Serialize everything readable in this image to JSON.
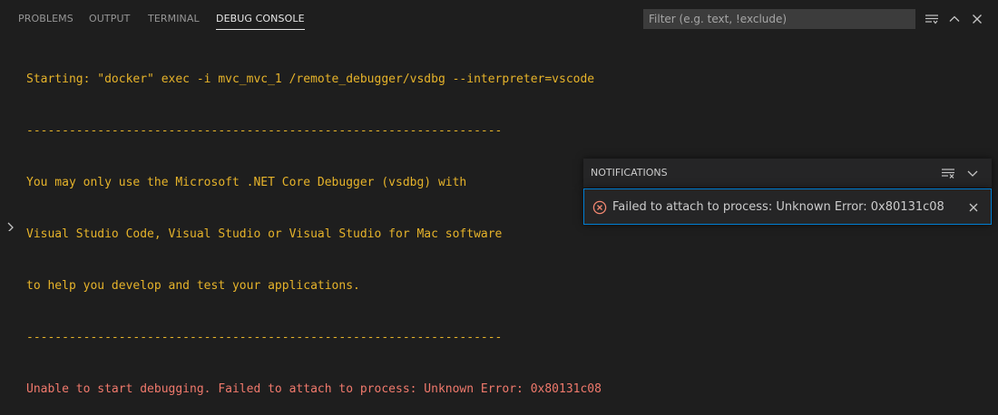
{
  "tabs": [
    {
      "label": "PROBLEMS",
      "active": false
    },
    {
      "label": "OUTPUT",
      "active": false
    },
    {
      "label": "TERMINAL",
      "active": false
    },
    {
      "label": "DEBUG CONSOLE",
      "active": true
    }
  ],
  "filter": {
    "value": "",
    "placeholder": "Filter (e.g. text, !exclude)"
  },
  "actions": [
    "collapse-all-icon",
    "maximize-panel-icon",
    "close-panel-icon"
  ],
  "console": {
    "lines": [
      {
        "text": "Starting: \"docker\" exec -i mvc_mvc_1 /remote_debugger/vsdbg --interpreter=vscode",
        "kind": "output"
      },
      {
        "text": "-------------------------------------------------------------------",
        "kind": "output"
      },
      {
        "text": "You may only use the Microsoft .NET Core Debugger (vsdbg) with",
        "kind": "output"
      },
      {
        "text": "Visual Studio Code, Visual Studio or Visual Studio for Mac software",
        "kind": "output"
      },
      {
        "text": "to help you develop and test your applications.",
        "kind": "output"
      },
      {
        "text": "-------------------------------------------------------------------",
        "kind": "output"
      },
      {
        "text": "Unable to start debugging. Failed to attach to process: Unknown Error: 0x80131c08",
        "kind": "error"
      }
    ]
  },
  "notifications": {
    "header": "NOTIFICATIONS",
    "items": [
      {
        "icon": "error-icon",
        "message": "Failed to attach to process: Unknown Error: 0x80131c08"
      }
    ]
  },
  "colors": {
    "background": "#1e1e1e",
    "console_output": "#e6b32a",
    "console_error": "#f0796c",
    "error_icon": "#f48771",
    "focus_border": "#007fd4"
  }
}
